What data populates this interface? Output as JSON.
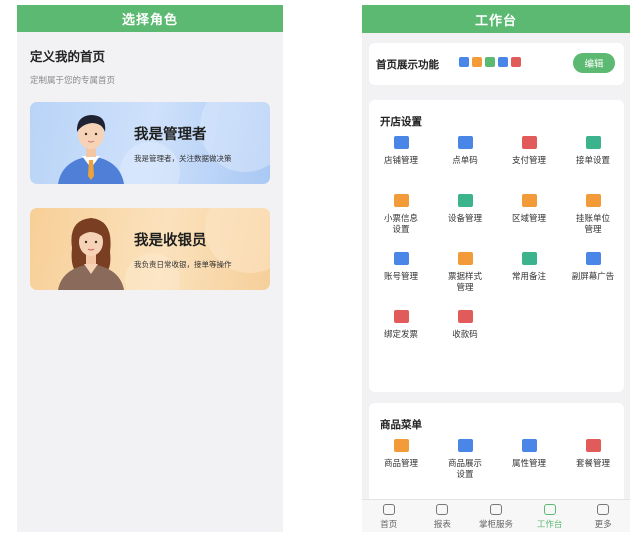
{
  "left": {
    "header_title": "选择角色",
    "intro_title": "定义我的首页",
    "intro_subtitle": "定制属于您的专属首页",
    "roles": [
      {
        "title": "我是管理者",
        "desc": "我是管理者，关注数据做决策",
        "figure": "male-manager-avatar"
      },
      {
        "title": "我是收银员",
        "desc": "我负责日常收银，接单等操作",
        "figure": "female-cashier-avatar"
      }
    ]
  },
  "right": {
    "header_title": "工作台",
    "feature_label": "首页展示功能",
    "edit_label": "编辑",
    "feature_icon_colors": [
      "#4a86e8",
      "#f29b38",
      "#5cb971",
      "#4a86e8",
      "#e25b5b"
    ],
    "shop_section": {
      "title": "开店设置",
      "items": [
        {
          "label": "店铺管理",
          "icon": "store-icon",
          "color": "#4a86e8"
        },
        {
          "label": "点单码",
          "icon": "qr-code-icon",
          "color": "#4a86e8"
        },
        {
          "label": "支付管理",
          "icon": "payment-icon",
          "color": "#e25b5b"
        },
        {
          "label": "接单设置",
          "icon": "order-settings-icon",
          "color": "#3bb38c"
        },
        {
          "label": "小票信息\n设置",
          "icon": "receipt-icon",
          "color": "#f29b38"
        },
        {
          "label": "设备管理",
          "icon": "device-icon",
          "color": "#3bb38c"
        },
        {
          "label": "区域管理",
          "icon": "area-icon",
          "color": "#f29b38"
        },
        {
          "label": "挂账单位\n管理",
          "icon": "credit-unit-icon",
          "color": "#f29b38"
        },
        {
          "label": "账号管理",
          "icon": "account-icon",
          "color": "#4a86e8"
        },
        {
          "label": "票据样式\n管理",
          "icon": "ticket-style-icon",
          "color": "#f29b38"
        },
        {
          "label": "常用备注",
          "icon": "note-icon",
          "color": "#3bb38c"
        },
        {
          "label": "副屏幕广告",
          "icon": "second-screen-ad-icon",
          "color": "#4a86e8"
        },
        {
          "label": "绑定发票",
          "icon": "invoice-icon",
          "color": "#e25b5b"
        },
        {
          "label": "收款码",
          "icon": "collect-code-icon",
          "color": "#e25b5b"
        }
      ]
    },
    "goods_section": {
      "title": "商品菜单",
      "items": [
        {
          "label": "商品管理",
          "icon": "goods-icon",
          "color": "#f29b38"
        },
        {
          "label": "商品展示\n设置",
          "icon": "goods-display-icon",
          "color": "#4a86e8"
        },
        {
          "label": "属性管理",
          "icon": "attribute-icon",
          "color": "#4a86e8"
        },
        {
          "label": "套餐管理",
          "icon": "combo-icon",
          "color": "#e25b5b"
        }
      ]
    },
    "tabs": [
      {
        "label": "首页",
        "icon": "home-icon"
      },
      {
        "label": "报表",
        "icon": "report-icon"
      },
      {
        "label": "掌柜服务",
        "icon": "crown-icon"
      },
      {
        "label": "工作台",
        "icon": "workbench-icon",
        "active": true
      },
      {
        "label": "更多",
        "icon": "more-icon"
      }
    ]
  }
}
